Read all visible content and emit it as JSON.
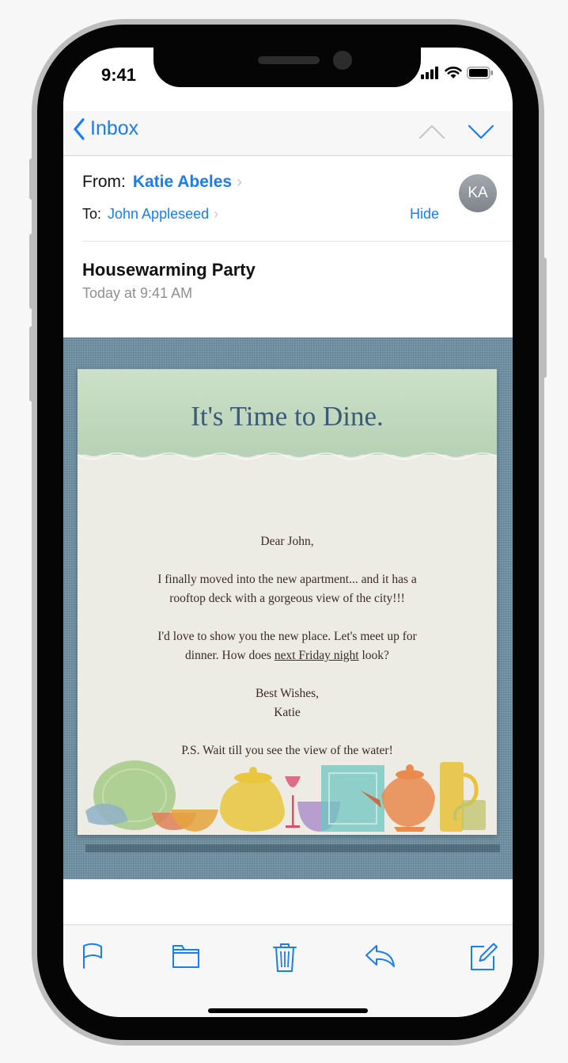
{
  "status_bar": {
    "time": "9:41"
  },
  "nav": {
    "back_label": "Inbox"
  },
  "header": {
    "from_label": "From:",
    "from_name": "Katie Abeles",
    "to_label": "To:",
    "to_name": "John Appleseed",
    "hide_label": "Hide",
    "avatar_initials": "KA"
  },
  "message": {
    "subject": "Housewarming Party",
    "date": "Today at 9:41 AM"
  },
  "letter": {
    "title": "It's Time to Dine.",
    "greeting": "Dear John,",
    "para1_line1": "I finally moved into the new apartment... and it has a",
    "para1_line2": "rooftop deck with a gorgeous view of the city!!!",
    "para2_line1": "I'd love to show you the new place. Let's meet up for",
    "para2_line2_prefix": "dinner. How does ",
    "para2_link": "next Friday night",
    "para2_line2_suffix": " look?",
    "closing": "Best Wishes,",
    "signature": "Katie",
    "postscript": "P.S. Wait till you see the view of the water!"
  },
  "toolbar": {
    "icons": [
      "flag-icon",
      "folder-icon",
      "trash-icon",
      "reply-icon",
      "compose-icon"
    ]
  },
  "colors": {
    "accent": "#1a7cf6",
    "linen": "#6e8fa2",
    "letter_title": "#3a5a78",
    "letter_header": "#c5dbc2"
  }
}
